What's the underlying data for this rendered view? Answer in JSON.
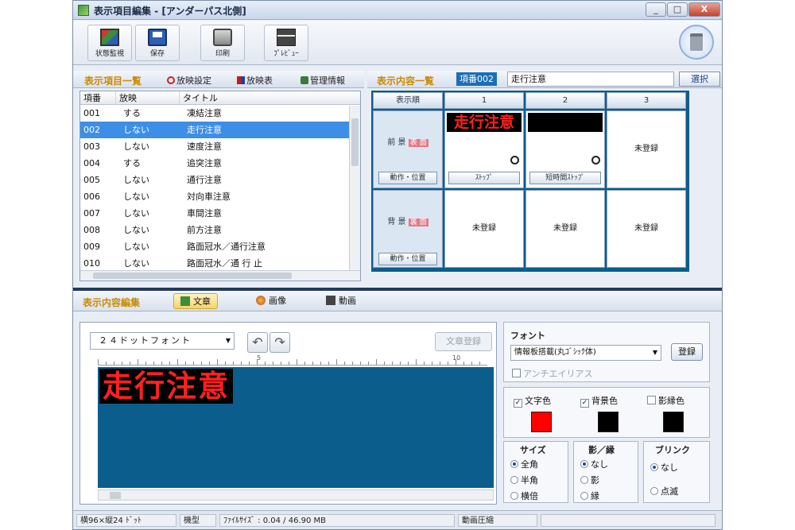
{
  "window": {
    "title": "表示項目編集 - [アンダーパス北側]",
    "controls": {
      "minimize": "_",
      "maximize": "□",
      "close": "X"
    }
  },
  "toolbar": {
    "monitor_label": "状態監視",
    "save_label": "保存",
    "print_label": "印刷",
    "preview_label": "ﾌﾟﾚﾋﾞｭｰ"
  },
  "item_panel": {
    "title": "表示項目一覧",
    "links": [
      "放映設定",
      "放映表",
      "管理情報"
    ],
    "columns": [
      "項番",
      "放映",
      "タイトル"
    ],
    "rows": [
      {
        "no": "001",
        "broadcast": "する",
        "title": "凍結注意"
      },
      {
        "no": "002",
        "broadcast": "しない",
        "title": "走行注意"
      },
      {
        "no": "003",
        "broadcast": "しない",
        "title": "速度注意"
      },
      {
        "no": "004",
        "broadcast": "する",
        "title": "追突注意"
      },
      {
        "no": "005",
        "broadcast": "しない",
        "title": "通行注意"
      },
      {
        "no": "006",
        "broadcast": "しない",
        "title": "対向車注意"
      },
      {
        "no": "007",
        "broadcast": "しない",
        "title": "車間注意"
      },
      {
        "no": "008",
        "broadcast": "しない",
        "title": "前方注意"
      },
      {
        "no": "009",
        "broadcast": "しない",
        "title": "路面冠水／通行注意"
      },
      {
        "no": "010",
        "broadcast": "しない",
        "title": "路面冠水／通 行 止"
      }
    ],
    "selected_index": 1,
    "scroll_label": "|||"
  },
  "content_panel": {
    "title": "表示内容一覧",
    "item_badge": "項番002",
    "item_title": "走行注意",
    "select_button": "選択",
    "col_header": "表示順",
    "columns": [
      "1",
      "2",
      "3"
    ],
    "rows": [
      {
        "label": "前 景",
        "tag": "表 面",
        "action": "動作・位置"
      },
      {
        "label": "背 景",
        "tag": "裏 面",
        "action": "動作・位置"
      }
    ],
    "cell_fg_1_text": "走行注意",
    "cell_fg_1_action": "ｽﾄｯﾌﾟ",
    "cell_fg_2_action": "短時間ｽﾄｯﾌﾟ",
    "unregistered": "未登録"
  },
  "edit_panel": {
    "title": "表示内容編集",
    "tabs": [
      "文章",
      "画像",
      "動画"
    ],
    "active_tab": 0,
    "font_select": "２４ドットフォント",
    "register_text": "文章登録",
    "ruler_marks": [
      "5",
      "10"
    ],
    "canvas_text": "走行注意"
  },
  "props": {
    "font_title": "フォント",
    "font_value": "情報板搭載(丸ｺﾞｼｯｸ体)",
    "register": "登録",
    "antialias": "アンチエイリアス",
    "colors": [
      {
        "label": "文字色",
        "checked": true,
        "value": "#ff0000"
      },
      {
        "label": "背景色",
        "checked": true,
        "value": "#000000"
      },
      {
        "label": "影縁色",
        "checked": false,
        "value": "#000000"
      }
    ],
    "size": {
      "title": "サイズ",
      "options": [
        "全角",
        "半角",
        "横倍"
      ],
      "selected": 0
    },
    "shadow": {
      "title": "影／縁",
      "options": [
        "なし",
        "影",
        "縁"
      ],
      "selected": 0
    },
    "blink": {
      "title": "ブリンク",
      "options": [
        "なし",
        "点滅"
      ],
      "selected": 0
    }
  },
  "status": {
    "dims": "横96×縦24 ﾄﾞｯﾄ",
    "model": "機型",
    "filesize": "ﾌｧｲﾙｻｲｽﾞ : 0.04 / 46.90 MB",
    "compress": "動画圧縮"
  },
  "colors": {
    "accent": "#c98a00",
    "selection": "#3d8ee6",
    "display_bg": "#0b5d8c",
    "display_text": "#ff2020"
  }
}
